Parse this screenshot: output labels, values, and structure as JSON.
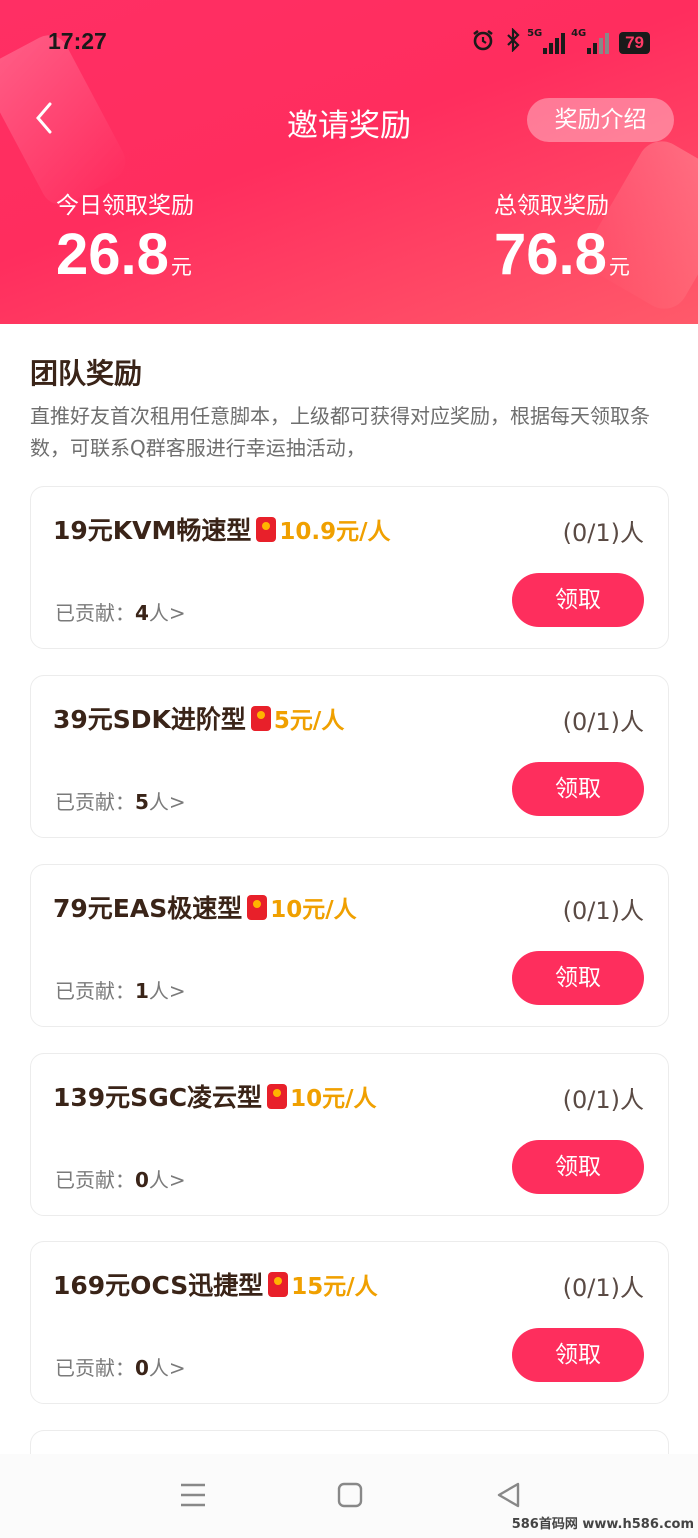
{
  "status_bar": {
    "time": "17:27",
    "network_tags": [
      "5G",
      "4G"
    ],
    "battery": "79",
    "icons": [
      "alarm-icon",
      "bluetooth-icon",
      "signal-5g-icon",
      "signal-4g-icon",
      "battery-icon"
    ]
  },
  "nav": {
    "back_icon": "chevron-left-icon",
    "title": "邀请奖励",
    "rules_button": "奖励介绍"
  },
  "stats": {
    "today_label": "今日领取奖励",
    "today_value": "26.8",
    "today_unit": "元",
    "total_label": "总领取奖励",
    "total_value": "76.8",
    "total_unit": "元"
  },
  "section": {
    "title": "团队奖励",
    "description": "直推好友首次租用任意脚本，上级都可获得对应奖励，根据每天领取条数，可联系Q群客服进行幸运抽活动，"
  },
  "cards": [
    {
      "title": "19元KVM畅速型",
      "reward": "10.9元/人",
      "count": "(0/1)人",
      "contrib_label": "已贡献：",
      "contrib_value": "4",
      "contrib_suffix": "人>",
      "button": "领取"
    },
    {
      "title": "39元SDK进阶型",
      "reward": "5元/人",
      "count": "(0/1)人",
      "contrib_label": "已贡献：",
      "contrib_value": "5",
      "contrib_suffix": "人>",
      "button": "领取"
    },
    {
      "title": "79元EAS极速型",
      "reward": "10元/人",
      "count": "(0/1)人",
      "contrib_label": "已贡献：",
      "contrib_value": "1",
      "contrib_suffix": "人>",
      "button": "领取"
    },
    {
      "title": "139元SGC凌云型",
      "reward": "10元/人",
      "count": "(0/1)人",
      "contrib_label": "已贡献：",
      "contrib_value": "0",
      "contrib_suffix": "人>",
      "button": "领取"
    },
    {
      "title": "169元OCS迅捷型",
      "reward": "15元/人",
      "count": "(0/1)人",
      "contrib_label": "已贡献：",
      "contrib_value": "0",
      "contrib_suffix": "人>",
      "button": "领取"
    }
  ],
  "bottom_nav": {
    "icons": [
      "menu-icon",
      "home-icon",
      "back-icon"
    ]
  },
  "watermark": "586首码网 www.h586.com",
  "colors": {
    "brand": "#fe2e5d",
    "reward": "#f0a000",
    "text_dark": "#3a2418"
  }
}
